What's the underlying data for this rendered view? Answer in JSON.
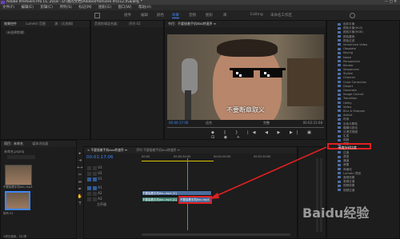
{
  "titlebar": {
    "title": "Adobe Premiere Pro CC 2018 - D:\\我的文档\\Adobe\\Premiere Pro\\12.0\\未命名 *"
  },
  "menubar": {
    "items": [
      "文件(F)",
      "编辑(E)",
      "剪辑(C)",
      "序列(S)",
      "标记(M)",
      "图形(G)",
      "窗口(W)",
      "帮助(H)"
    ]
  },
  "workspaces": {
    "tabs": [
      "组件",
      "编辑",
      "颜色",
      "效果",
      "音频",
      "图形",
      "库"
    ],
    "active": "效果",
    "extra": [
      "Editing",
      "未命名工作区"
    ]
  },
  "left_panel": {
    "tabs": [
      "效果控件",
      "Lumetri 范围",
      "源：(无剪辑)"
    ],
    "empty": "（未选择剪辑）"
  },
  "source_panel": {
    "tabs": [
      "音频剪辑混合器：",
      "序列 02"
    ],
    "title": "节目：不要接着手机dou转速序 ≡"
  },
  "program": {
    "title": "节目：不要接着手机dou特速序 ≡",
    "subtitle": "不要断章取义",
    "timecode": "00:00:17:06",
    "fit": "适合",
    "quality": "完整",
    "duration": "00:02:21:08"
  },
  "effects": {
    "items": [
      "色彩平衡",
      "颜色平衡(HLS)",
      "颜色平衡(RGB)",
      "颜色替换",
      "颜色过滤",
      "Immersive Video",
      "Obsolete",
      "Keying",
      "Noise",
      "Perspective",
      "Render",
      "Sequences",
      "Stylize",
      "Channel",
      "Color Correction",
      "Distort",
      "Generate",
      "Image Control",
      "Transition",
      "Utility",
      "Video",
      "Blur & Sharpen",
      "Adjust",
      "时间",
      "杂色与颗粒",
      "模糊与锐化",
      "沉浸式视频",
      "生成",
      "视频",
      "调整",
      "过时",
      "过渡",
      "透视",
      "通道",
      "遮罩",
      "风格化",
      "Lumetri 预设",
      "音频效果",
      "音频过渡",
      "视频效果",
      "视频过渡"
    ],
    "highlight": "亮度与对比度"
  },
  "project": {
    "tabs": [
      "项目：未命名",
      "媒体浏览器"
    ],
    "name": "未命名.prproj",
    "items": [
      "不要接着手机dou.mp4",
      "序列 01"
    ],
    "status": "1项已选择，共2项"
  },
  "timeline": {
    "tabs": [
      "×  不要接着手机dou转速序 ≡",
      "序列 不要接着手机dou转速序 ≡"
    ],
    "timecode": "00:01:17:06",
    "tracks": [
      "V3",
      "V2",
      "V1",
      "A1",
      "A2",
      "A3"
    ],
    "clips": {
      "v1": "不要接着手机dou.mp4 [V]",
      "a1": "不要接着手机dou.mp4 [A]",
      "cut": "不要接着手机dou.mp4"
    },
    "ruler": [
      "00:00",
      "00:00:30:00",
      "00:01:00:00",
      "00:01:30:00"
    ],
    "master": "主声道"
  },
  "watermark": "Baidu经验"
}
